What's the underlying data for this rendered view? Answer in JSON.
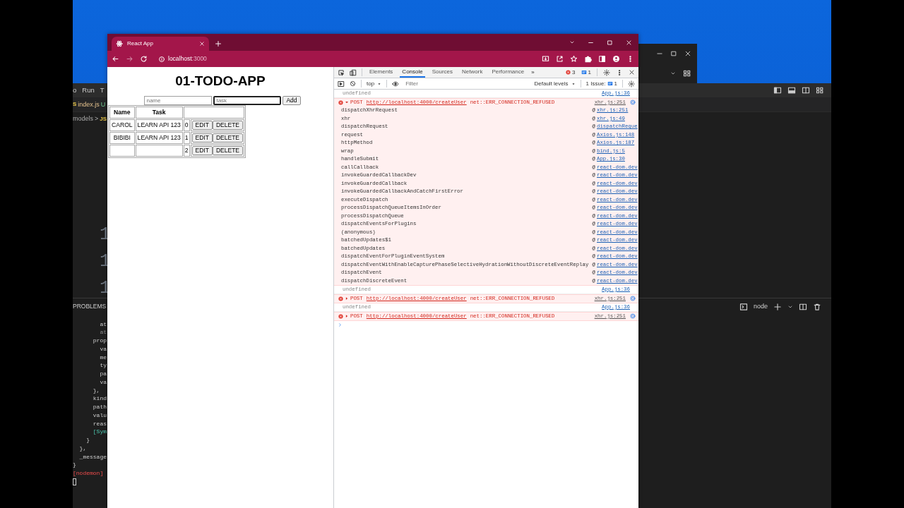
{
  "background_editor": {
    "menu": [
      "o",
      "Run",
      "T"
    ],
    "tab": {
      "badge": "S",
      "label": "index.js",
      "status": "U"
    },
    "breadcrumb": {
      "folder": "models",
      "separator": ">",
      "badge": "JS"
    },
    "line_numbers": [
      "1",
      "1",
      "1"
    ],
    "panel_title": "PROBLEMS",
    "terminal_name": "node",
    "terminal_lines": [
      {
        "text": "        at",
        "kind": "output"
      },
      {
        "text": "        at",
        "kind": "dim"
      },
      {
        "text": "      prop",
        "kind": "output"
      },
      {
        "text": "        va",
        "kind": "output"
      },
      {
        "text": "        me",
        "kind": "output"
      },
      {
        "text": "        ty",
        "kind": "output"
      },
      {
        "text": "        pa",
        "kind": "output"
      },
      {
        "text": "        va",
        "kind": "output"
      },
      {
        "text": "      },",
        "kind": "output"
      },
      {
        "text": "      kind",
        "kind": "output"
      },
      {
        "text": "      path",
        "kind": "output"
      },
      {
        "text": "      valu",
        "kind": "output"
      },
      {
        "text": "      reas",
        "kind": "output"
      },
      {
        "text": "      [Sym",
        "kind": "symbol"
      },
      {
        "text": "    }",
        "kind": "output"
      },
      {
        "text": "  },",
        "kind": "output"
      },
      {
        "text": "  _message",
        "kind": "output"
      },
      {
        "text": "}",
        "kind": "output"
      },
      {
        "text": "[nodemon]",
        "kind": "tag"
      }
    ]
  },
  "browser": {
    "tab_title": "React App",
    "url_host": "localhost",
    "url_port": ":3000"
  },
  "app": {
    "title": "01-TODO-APP",
    "inputs": [
      {
        "placeholder": "name",
        "focused": false
      },
      {
        "placeholder": "task",
        "focused": true
      }
    ],
    "add_label": "Add",
    "columns": [
      "Name",
      "Task"
    ],
    "rows": [
      {
        "name": "CAROL",
        "task": "LEARN API 123",
        "index": "0",
        "edit": "EDIT",
        "delete": "DELETE"
      },
      {
        "name": "BIBIBI",
        "task": "LEARN API 123",
        "index": "1",
        "edit": "EDIT",
        "delete": "DELETE"
      },
      {
        "index": "2",
        "edit": "EDIT",
        "delete": "DELETE"
      }
    ]
  },
  "devtools": {
    "tabs": [
      {
        "label": "Elements",
        "selected": false
      },
      {
        "label": "Console",
        "selected": true
      },
      {
        "label": "Sources",
        "selected": false
      },
      {
        "label": "Network",
        "selected": false
      },
      {
        "label": "Performance",
        "selected": false
      }
    ],
    "more": "»",
    "error_count": "3",
    "message_count": "1",
    "context": "top",
    "filter_placeholder": "Filter",
    "levels": "Default levels",
    "issues_label": "1 Issue:",
    "issues_count": "1",
    "entries": [
      {
        "kind": "log",
        "text": "undefined",
        "source": "App.js:36"
      },
      {
        "kind": "error",
        "expanded": true,
        "method": "POST",
        "url": "http://localhost:4000/createUser",
        "message": "net::ERR_CONNECTION_REFUSED",
        "source": "xhr.js:251",
        "stack": [
          {
            "function": "dispatchXhrRequest",
            "at": "@",
            "location": "xhr.js:251"
          },
          {
            "function": "xhr",
            "at": "@",
            "location": "xhr.js:49"
          },
          {
            "function": "dispatchRequest",
            "at": "@",
            "location": "dispatchReque"
          },
          {
            "function": "request",
            "at": "@",
            "location": "Axios.js:148"
          },
          {
            "function": "httpMethod",
            "at": "@",
            "location": "Axios.js:187"
          },
          {
            "function": "wrap",
            "at": "@",
            "location": "bind.js:5"
          },
          {
            "function": "handleSubmit",
            "at": "@",
            "location": "App.js:30"
          },
          {
            "function": "callCallback",
            "at": "@",
            "location": "react-dom.dev"
          },
          {
            "function": "invokeGuardedCallbackDev",
            "at": "@",
            "location": "react-dom.dev"
          },
          {
            "function": "invokeGuardedCallback",
            "at": "@",
            "location": "react-dom.dev"
          },
          {
            "function": "invokeGuardedCallbackAndCatchFirstError",
            "at": "@",
            "location": "react-dom.dev"
          },
          {
            "function": "executeDispatch",
            "at": "@",
            "location": "react-dom.dev"
          },
          {
            "function": "processDispatchQueueItemsInOrder",
            "at": "@",
            "location": "react-dom.dev"
          },
          {
            "function": "processDispatchQueue",
            "at": "@",
            "location": "react-dom.dev"
          },
          {
            "function": "dispatchEventsForPlugins",
            "at": "@",
            "location": "react-dom.dev"
          },
          {
            "function": "(anonymous)",
            "at": "@",
            "location": "react-dom.dev"
          },
          {
            "function": "batchedUpdates$1",
            "at": "@",
            "location": "react-dom.dev"
          },
          {
            "function": "batchedUpdates",
            "at": "@",
            "location": "react-dom.dev"
          },
          {
            "function": "dispatchEventForPluginEventSystem",
            "at": "@",
            "location": "react-dom.dev"
          },
          {
            "function": "dispatchEventWithEnableCapturePhaseSelectiveHydrationWithoutDiscreteEventReplay",
            "at": "@",
            "location": "react-dom.dev"
          },
          {
            "function": "dispatchEvent",
            "at": "@",
            "location": "react-dom.dev"
          },
          {
            "function": "dispatchDiscreteEvent",
            "at": "@",
            "location": "react-dom.dev"
          }
        ]
      },
      {
        "kind": "log",
        "text": "undefined",
        "source": "App.js:36"
      },
      {
        "kind": "error",
        "expanded": false,
        "method": "POST",
        "url": "http://localhost:4000/createUser",
        "message": "net::ERR_CONNECTION_REFUSED",
        "source": "xhr.js:251"
      },
      {
        "kind": "log",
        "text": "undefined",
        "source": "App.js:36"
      },
      {
        "kind": "error",
        "expanded": false,
        "method": "POST",
        "url": "http://localhost:4000/createUser",
        "message": "net::ERR_CONNECTION_REFUSED",
        "source": "xhr.js:251"
      }
    ]
  }
}
